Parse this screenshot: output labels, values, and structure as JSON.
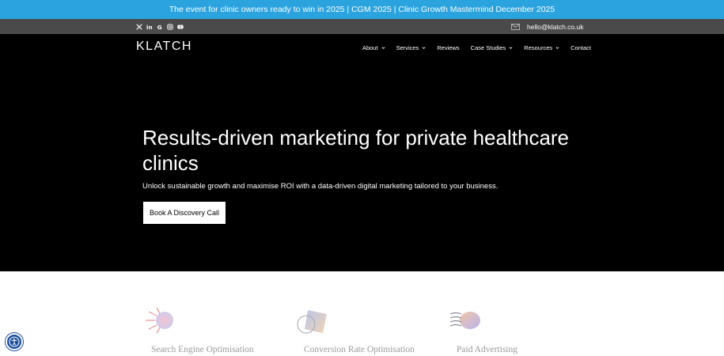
{
  "announcement": {
    "text": "The event for clinic owners ready to win in 2025 | CGM 2025 | Clinic Growth Mastermind December 2025"
  },
  "utility": {
    "social_icons": [
      "x-icon",
      "linkedin-icon",
      "google-icon",
      "instagram-icon",
      "youtube-icon"
    ],
    "email": "hello@klatch.co.uk"
  },
  "header": {
    "logo": "KLATCH",
    "nav": [
      {
        "label": "About",
        "has_dropdown": true
      },
      {
        "label": "Services",
        "has_dropdown": true
      },
      {
        "label": "Reviews",
        "has_dropdown": false
      },
      {
        "label": "Case Studies",
        "has_dropdown": true
      },
      {
        "label": "Resources",
        "has_dropdown": true
      },
      {
        "label": "Contact",
        "has_dropdown": false
      }
    ]
  },
  "hero": {
    "headline": "Results-driven marketing for private healthcare clinics",
    "subheadline": "Unlock sustainable growth and maximise ROI with a data-driven digital marketing tailored to  your business.",
    "cta_label": "Book A Discovery Call"
  },
  "services": [
    {
      "label": "Search Engine Optimisation",
      "icon": "seo-burst-icon"
    },
    {
      "label": "Conversion Rate Optimisation",
      "icon": "cro-prism-icon"
    },
    {
      "label": "Paid Advertising",
      "icon": "paid-ads-icon"
    }
  ],
  "colors": {
    "announcement_bg": "#2aa3df",
    "utility_bg": "#4a4a4a",
    "hero_bg": "#000000",
    "accessibility_button": "#1b4f9e"
  }
}
